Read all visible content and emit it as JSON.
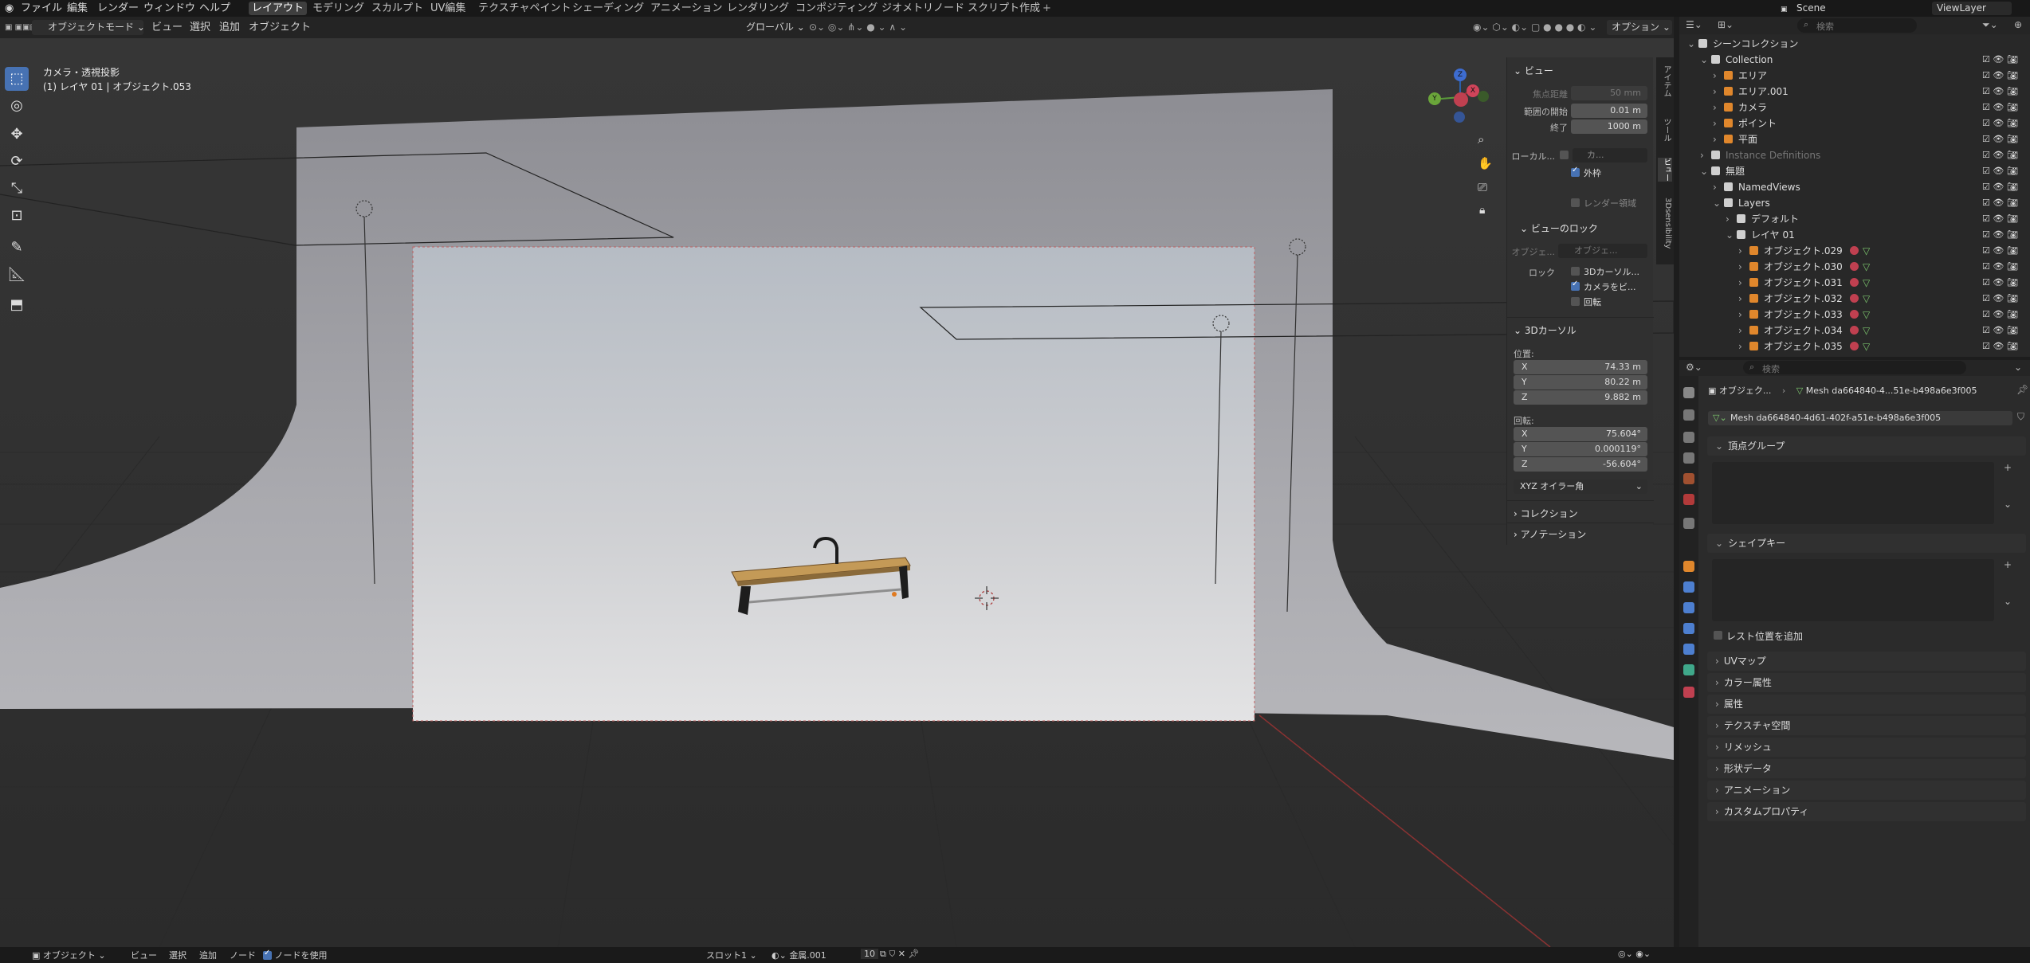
{
  "topbar": {
    "menus": [
      "ファイル",
      "編集",
      "レンダー",
      "ウィンドウ",
      "ヘルプ"
    ],
    "tabs": [
      "レイアウト",
      "モデリング",
      "スカルプト",
      "UV編集",
      "テクスチャペイント",
      "シェーディング",
      "アニメーション",
      "レンダリング",
      "コンポジティング",
      "ジオメトリノード",
      "スクリプト作成"
    ],
    "add_tab": "+",
    "scene": "Scene",
    "viewlayer": "ViewLayer"
  },
  "header": {
    "mode": "オブジェクトモード",
    "menus": [
      "ビュー",
      "選択",
      "追加",
      "オブジェクト"
    ],
    "orientation": "グローバル",
    "options": "オプション"
  },
  "viewport": {
    "camera_label": "カメラ・透視投影",
    "object_label": "(1) レイヤ 01 | オブジェクト.053",
    "gizmo": {
      "x": "X",
      "y": "Y",
      "z": "Z"
    }
  },
  "npanel": {
    "view_title": "ビュー",
    "focal_label": "焦点距離",
    "focal_value": "50 mm",
    "clip_start_label": "範囲の開始",
    "clip_start_value": "0.01 m",
    "clip_end_label": "終了",
    "clip_end_value": "1000 m",
    "local_label": "ローカル...",
    "local_value": "カ...",
    "outline_label": "外枠",
    "render_region_label": "レンダー領域",
    "lock_title": "ビューのロック",
    "lock_obj_label": "オブジェ...",
    "lock_obj_value": "オブジェ...",
    "lock_label": "ロック",
    "lock_cursor": "3Dカーソル...",
    "lock_camera": "カメラをビ...",
    "lock_rotation": "回転",
    "cursor_title": "3Dカーソル",
    "location_label": "位置:",
    "loc_x": "74.33 m",
    "loc_y": "80.22 m",
    "loc_z": "9.882 m",
    "rotation_label": "回転:",
    "rot_x": "75.604°",
    "rot_y": "0.000119°",
    "rot_z": "-56.604°",
    "rotation_mode": "XYZ オイラー角",
    "collection_title": "コレクション",
    "annotation_title": "アノテーション",
    "x": "X",
    "y": "Y",
    "z": "Z"
  },
  "vtabs": [
    "アイテム",
    "ツール",
    "ビュー",
    "3Dsensibility"
  ],
  "outliner": {
    "search_placeholder": "検索",
    "rows": [
      {
        "name": "シーンコレクション",
        "depth": 0
      },
      {
        "name": "Collection",
        "depth": 1
      },
      {
        "name": "エリア",
        "depth": 2
      },
      {
        "name": "エリア.001",
        "depth": 2
      },
      {
        "name": "カメラ",
        "depth": 2
      },
      {
        "name": "ポイント",
        "depth": 2
      },
      {
        "name": "平面",
        "depth": 2
      },
      {
        "name": "Instance Definitions",
        "depth": 1
      },
      {
        "name": "無題",
        "depth": 1
      },
      {
        "name": "NamedViews",
        "depth": 2
      },
      {
        "name": "Layers",
        "depth": 2
      },
      {
        "name": "デフォルト",
        "depth": 3
      },
      {
        "name": "レイヤ 01",
        "depth": 3
      },
      {
        "name": "オブジェクト.029",
        "depth": 4
      },
      {
        "name": "オブジェクト.030",
        "depth": 4
      },
      {
        "name": "オブジェクト.031",
        "depth": 4
      },
      {
        "name": "オブジェクト.032",
        "depth": 4
      },
      {
        "name": "オブジェクト.033",
        "depth": 4
      },
      {
        "name": "オブジェクト.034",
        "depth": 4
      },
      {
        "name": "オブジェクト.035",
        "depth": 4
      }
    ]
  },
  "properties": {
    "search_placeholder": "検索",
    "breadcrumb_obj": "オブジェク...",
    "breadcrumb_mesh": "Mesh da664840-4...51e-b498a6e3f005",
    "mesh_name": "Mesh da664840-4d61-402f-a51e-b498a6e3f005",
    "vertex_groups": "頂点グループ",
    "shape_keys": "シェイプキー",
    "add_rest_position": "レスト位置を追加",
    "sections": [
      "UVマップ",
      "カラー属性",
      "属性",
      "テクスチャ空間",
      "リメッシュ",
      "形状データ",
      "アニメーション",
      "カスタムプロパティ"
    ]
  },
  "statusbar": {
    "mode": "オブジェクト",
    "menus": [
      "ビュー",
      "選択",
      "追加",
      "ノード"
    ],
    "use_nodes": "ノードを使用",
    "slot": "スロット1",
    "material": "金属.001",
    "users": "10"
  }
}
